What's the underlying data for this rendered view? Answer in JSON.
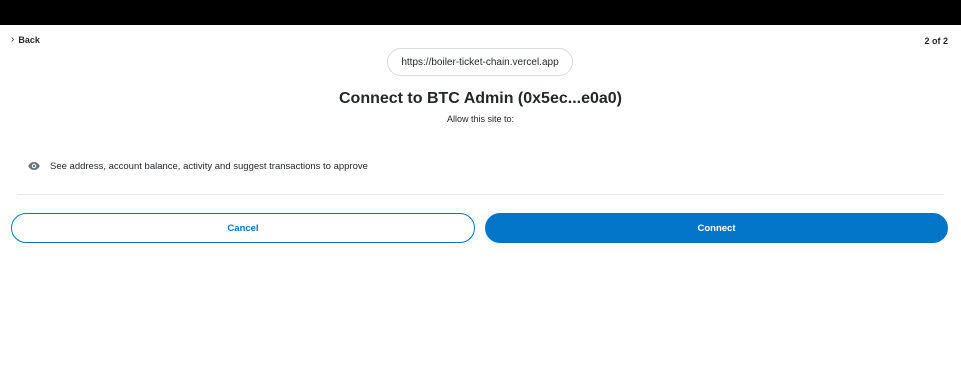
{
  "header": {
    "back_label": "Back",
    "page_indicator": "2 of 2"
  },
  "origin": {
    "url": "https://boiler-ticket-chain.vercel.app"
  },
  "title": "Connect to BTC Admin (0x5ec...e0a0)",
  "subtitle": "Allow this site to:",
  "permissions": [
    {
      "icon": "eye-icon",
      "text": "See address, account balance, activity and suggest transactions to approve"
    }
  ],
  "actions": {
    "cancel_label": "Cancel",
    "connect_label": "Connect"
  },
  "colors": {
    "primary": "#0376c9",
    "text": "#24272a",
    "topbar": "#000000"
  }
}
